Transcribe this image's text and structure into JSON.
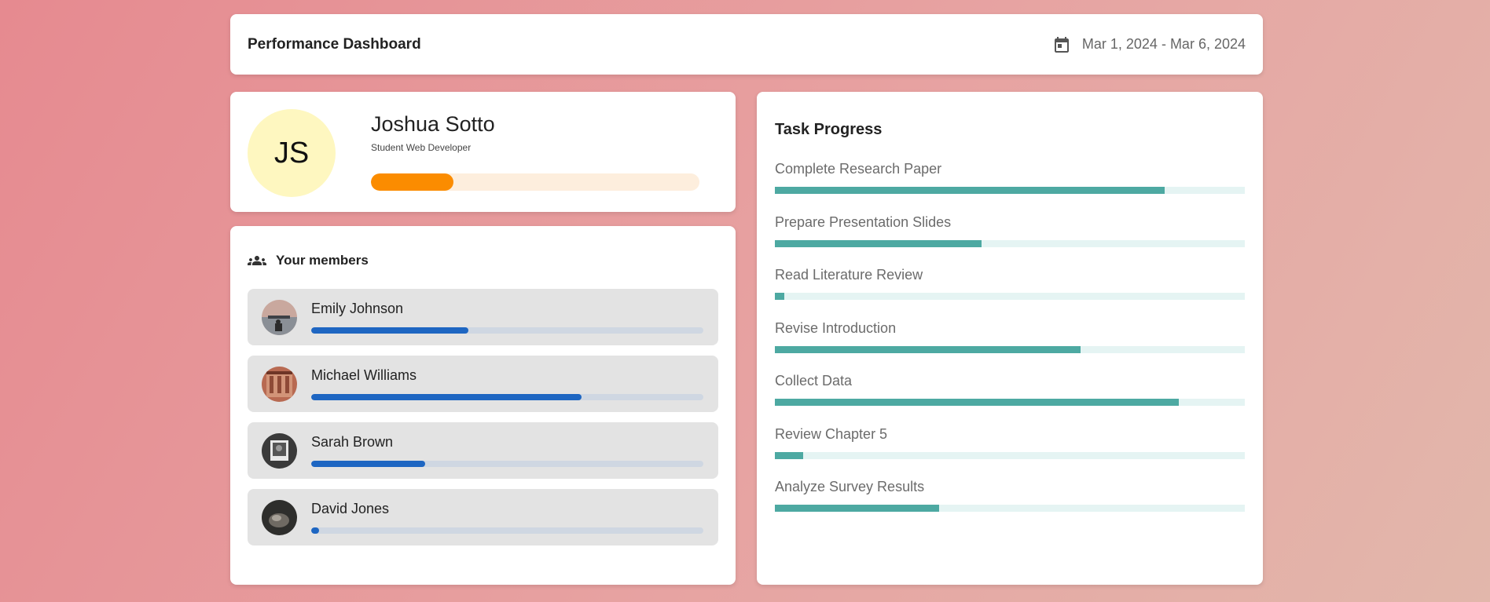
{
  "header": {
    "title": "Performance Dashboard",
    "date_range": "Mar 1, 2024 - Mar 6, 2024",
    "date_icon": "calendar-icon"
  },
  "profile": {
    "initials": "JS",
    "name": "Joshua Sotto",
    "role": "Student Web Developer",
    "progress": 0.25,
    "colors": {
      "avatar_bg": "#fef7c0",
      "bar": "#fb8c00",
      "track": "#fdeedd"
    }
  },
  "members": {
    "title": "Your members",
    "icon": "group-icon",
    "bar_color": "#1e66c2",
    "items": [
      {
        "name": "Emily Johnson",
        "progress": 0.4,
        "avatar": "photo-avatar"
      },
      {
        "name": "Michael Williams",
        "progress": 0.69,
        "avatar": "photo-avatar"
      },
      {
        "name": "Sarah Brown",
        "progress": 0.29,
        "avatar": "photo-avatar"
      },
      {
        "name": "David Jones",
        "progress": 0.02,
        "avatar": "photo-avatar"
      }
    ]
  },
  "tasks": {
    "title": "Task Progress",
    "bar_color": "#4da9a2",
    "items": [
      {
        "label": "Complete Research Paper",
        "progress": 0.83
      },
      {
        "label": "Prepare Presentation Slides",
        "progress": 0.44
      },
      {
        "label": "Read Literature Review",
        "progress": 0.02
      },
      {
        "label": "Revise Introduction",
        "progress": 0.65
      },
      {
        "label": "Collect Data",
        "progress": 0.86
      },
      {
        "label": "Review Chapter 5",
        "progress": 0.06
      },
      {
        "label": "Analyze Survey Results",
        "progress": 0.35
      }
    ]
  }
}
